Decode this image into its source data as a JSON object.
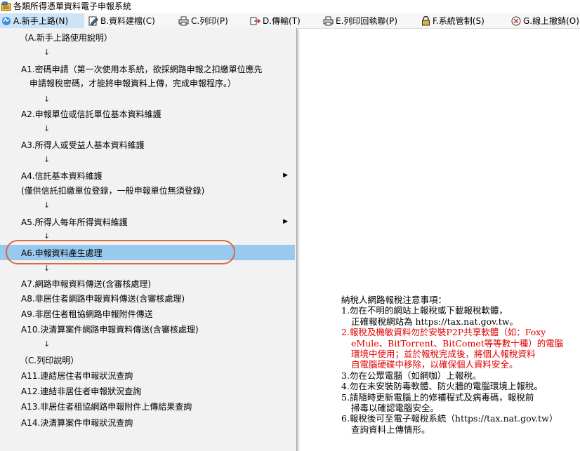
{
  "window": {
    "title": "各類所得憑單資料電子申報系統"
  },
  "menubar": {
    "items": [
      {
        "label": "A.新手上路(N)"
      },
      {
        "label": "B.資料建檔(C)"
      },
      {
        "label": "C.列印(P)"
      },
      {
        "label": "D.傳輸(T)"
      },
      {
        "label": "E.列印回執聯(P)"
      },
      {
        "label": "F.系統管制(S)"
      },
      {
        "label": "G.線上撤銷(O)"
      }
    ]
  },
  "dropdown": {
    "header_a": "（A.新手上路使用說明）",
    "arrow": "↓",
    "a1_line1": "A1.密碼申請（第一次使用本系統，欲採網路申報之扣繳單位應先",
    "a1_line2": "申請報稅密碼，才能將申報資料上傳，完成申報程序。）",
    "a2": "A2.申報單位或信託單位基本資料維護",
    "a3": "A3.所得人或受益人基本資料維護",
    "a4": "A4.信託基本資料維護",
    "a4_note": "(僅供信託扣繳單位登錄，一般申報單位無須登錄)",
    "a5": "A5.所得人每年所得資料維護",
    "a6": "A6.申報資料產生處理",
    "a7": "A7.網路申報資料傳送(含審核處理)",
    "a8": "A8.非居住者網路申報資料傳送(含審核處理)",
    "a9": "A9.非居住者租協網路申報附件傳送",
    "a10": "A10.決清算案件網路申報資料傳送(含審核處理)",
    "header_c": "（C.列印說明）",
    "a11": "A11.連結居住者申報狀況查詢",
    "a12": "A12.連結非居住者申報狀況查詢",
    "a13": "A13.非居住者租協網路申報附件上傳結果查詢",
    "a14": "A14.決清算案件申報狀況查詢",
    "submenu_glyph": "▶"
  },
  "notice": {
    "title": "納稅人網路報稅注意事項：",
    "l1a": "1.勿在不明的網站上報稅或下載報稅軟體，",
    "l1b": "正確報稅網站為 https://tax.nat.gov.tw。",
    "l2a": "2.報稅及機敏資料勿於安裝P2P共享軟體（如：Foxy",
    "l2b": "eMule、BitTorrent、BitComet等等數十種）的電腦",
    "l2c": "環境中使用；並於報稅完成後，將個人報稅資料",
    "l2d": "自電腦硬碟中移除，以確保個人資料安全。",
    "l3": "3.勿在公眾電腦（如網咖）上報稅。",
    "l4": "4.勿在未安裝防毒軟體、防火牆的電腦環境上報稅。",
    "l5a": "5.請隨時更新電腦上的修補程式及病毒碼，報稅前",
    "l5b": "掃毒以確認電腦安全。",
    "l6a": "6.報稅後可至電子報稅系統（https://tax.nat.gov.tw）",
    "l6b": "查詢資料上傳情形。"
  },
  "colors": {
    "highlight": "#99c9ef",
    "annotation": "#d9693e",
    "warning": "#e00000"
  }
}
